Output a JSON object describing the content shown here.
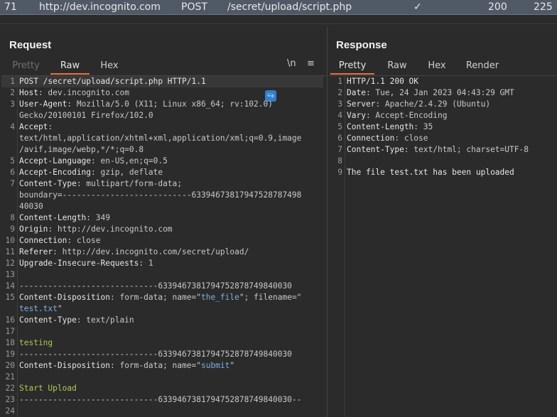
{
  "history_row": {
    "id": "71",
    "host": "http://dev.incognito.com",
    "method": "POST",
    "url": "/secret/upload/script.php",
    "check": "✓",
    "status": "200",
    "length": "225"
  },
  "request": {
    "title": "Request",
    "tabs": [
      "Pretty",
      "Raw",
      "Hex"
    ],
    "active_tab": "Raw",
    "tool_icons": [
      "wrap-icon",
      "newline-icon",
      "menu-icon"
    ],
    "newline_label": "\\n",
    "menu_label": "≡",
    "lines": [
      {
        "n": "1",
        "parts": [
          {
            "t": "POST /secret/upload/script.php HTTP/1.1",
            "c": "k"
          }
        ]
      },
      {
        "n": "2",
        "parts": [
          {
            "t": "Host",
            "c": "k"
          },
          {
            "t": ": dev.incognito.com",
            "c": "v"
          }
        ]
      },
      {
        "n": "3",
        "parts": [
          {
            "t": "User-Agent",
            "c": "k"
          },
          {
            "t": ": Mozilla/5.0 (X11; Linux x86_64; rv:102.0)",
            "c": "v"
          }
        ]
      },
      {
        "n": "",
        "parts": [
          {
            "t": "Gecko/20100101 Firefox/102.0",
            "c": "v"
          }
        ]
      },
      {
        "n": "4",
        "parts": [
          {
            "t": "Accept",
            "c": "k"
          },
          {
            "t": ":",
            "c": "v"
          }
        ]
      },
      {
        "n": "",
        "parts": [
          {
            "t": "text/html,application/xhtml+xml,application/xml;q=0.9,image",
            "c": "v"
          }
        ]
      },
      {
        "n": "",
        "parts": [
          {
            "t": "/avif,image/webp,*/*;q=0.8",
            "c": "v"
          }
        ]
      },
      {
        "n": "5",
        "parts": [
          {
            "t": "Accept-Language",
            "c": "k"
          },
          {
            "t": ": en-US,en;q=0.5",
            "c": "v"
          }
        ]
      },
      {
        "n": "6",
        "parts": [
          {
            "t": "Accept-Encoding",
            "c": "k"
          },
          {
            "t": ": gzip, deflate",
            "c": "v"
          }
        ]
      },
      {
        "n": "7",
        "parts": [
          {
            "t": "Content-Type",
            "c": "k"
          },
          {
            "t": ": multipart/form-data;",
            "c": "v"
          }
        ]
      },
      {
        "n": "",
        "parts": [
          {
            "t": "boundary=---------------------------63394673817947528787498",
            "c": "v"
          }
        ]
      },
      {
        "n": "",
        "parts": [
          {
            "t": "40030",
            "c": "v"
          }
        ]
      },
      {
        "n": "8",
        "parts": [
          {
            "t": "Content-Length",
            "c": "k"
          },
          {
            "t": ": 349",
            "c": "v"
          }
        ]
      },
      {
        "n": "9",
        "parts": [
          {
            "t": "Origin",
            "c": "k"
          },
          {
            "t": ": http://dev.incognito.com",
            "c": "v"
          }
        ]
      },
      {
        "n": "10",
        "parts": [
          {
            "t": "Connection",
            "c": "k"
          },
          {
            "t": ": close",
            "c": "v"
          }
        ]
      },
      {
        "n": "11",
        "parts": [
          {
            "t": "Referer",
            "c": "k"
          },
          {
            "t": ": http://dev.incognito.com/secret/upload/",
            "c": "v"
          }
        ]
      },
      {
        "n": "12",
        "parts": [
          {
            "t": "Upgrade-Insecure-Requests",
            "c": "k"
          },
          {
            "t": ": 1",
            "c": "v"
          }
        ]
      },
      {
        "n": "13",
        "parts": []
      },
      {
        "n": "14",
        "parts": [
          {
            "t": "-----------------------------6339467381794752878749840030",
            "c": "v"
          }
        ]
      },
      {
        "n": "15",
        "parts": [
          {
            "t": "Content-Disposition",
            "c": "k"
          },
          {
            "t": ": form-data; name=\"",
            "c": "v"
          },
          {
            "t": "the_file",
            "c": "s"
          },
          {
            "t": "\"; filename=\"",
            "c": "v"
          }
        ]
      },
      {
        "n": "",
        "parts": [
          {
            "t": "test.txt",
            "c": "s"
          },
          {
            "t": "\"",
            "c": "v"
          }
        ]
      },
      {
        "n": "16",
        "parts": [
          {
            "t": "Content-Type",
            "c": "k"
          },
          {
            "t": ": text/plain",
            "c": "v"
          }
        ]
      },
      {
        "n": "17",
        "parts": []
      },
      {
        "n": "18",
        "parts": [
          {
            "t": "testing",
            "c": "g"
          }
        ]
      },
      {
        "n": "19",
        "parts": [
          {
            "t": "-----------------------------6339467381794752878749840030",
            "c": "v"
          }
        ]
      },
      {
        "n": "20",
        "parts": [
          {
            "t": "Content-Disposition",
            "c": "k"
          },
          {
            "t": ": form-data; name=\"",
            "c": "v"
          },
          {
            "t": "submit",
            "c": "s"
          },
          {
            "t": "\"",
            "c": "v"
          }
        ]
      },
      {
        "n": "21",
        "parts": []
      },
      {
        "n": "22",
        "parts": [
          {
            "t": "Start Upload",
            "c": "g"
          }
        ]
      },
      {
        "n": "23",
        "parts": [
          {
            "t": "-----------------------------6339467381794752878749840030--",
            "c": "v"
          }
        ]
      },
      {
        "n": "24",
        "parts": []
      }
    ]
  },
  "response": {
    "title": "Response",
    "tabs": [
      "Pretty",
      "Raw",
      "Hex",
      "Render"
    ],
    "active_tab": "Pretty",
    "lines": [
      {
        "n": "1",
        "parts": [
          {
            "t": "HTTP/1.1 200 OK",
            "c": "k"
          }
        ]
      },
      {
        "n": "2",
        "parts": [
          {
            "t": "Date",
            "c": "k"
          },
          {
            "t": ": Tue, 24 Jan 2023 04:43:29 GMT",
            "c": "v"
          }
        ]
      },
      {
        "n": "3",
        "parts": [
          {
            "t": "Server",
            "c": "k"
          },
          {
            "t": ": Apache/2.4.29 (Ubuntu)",
            "c": "v"
          }
        ]
      },
      {
        "n": "4",
        "parts": [
          {
            "t": "Vary",
            "c": "k"
          },
          {
            "t": ": Accept-Encoding",
            "c": "v"
          }
        ]
      },
      {
        "n": "5",
        "parts": [
          {
            "t": "Content-Length",
            "c": "k"
          },
          {
            "t": ": 35",
            "c": "v"
          }
        ]
      },
      {
        "n": "6",
        "parts": [
          {
            "t": "Connection",
            "c": "k"
          },
          {
            "t": ": close",
            "c": "v"
          }
        ]
      },
      {
        "n": "7",
        "parts": [
          {
            "t": "Content-Type",
            "c": "k"
          },
          {
            "t": ": text/html; charset=UTF-8",
            "c": "v"
          }
        ]
      },
      {
        "n": "8",
        "parts": []
      },
      {
        "n": "9",
        "parts": [
          {
            "t": "The file test.txt has been uploaded",
            "c": "k"
          }
        ]
      }
    ]
  },
  "colors": {
    "accent_tab": "#e8733a",
    "history_row_bg": "#505a66",
    "wrap_icon": "#2f7fd0",
    "key_text": "#e6e6e6",
    "string_text": "#7fb0e0",
    "body_text": "#a9c95a"
  }
}
